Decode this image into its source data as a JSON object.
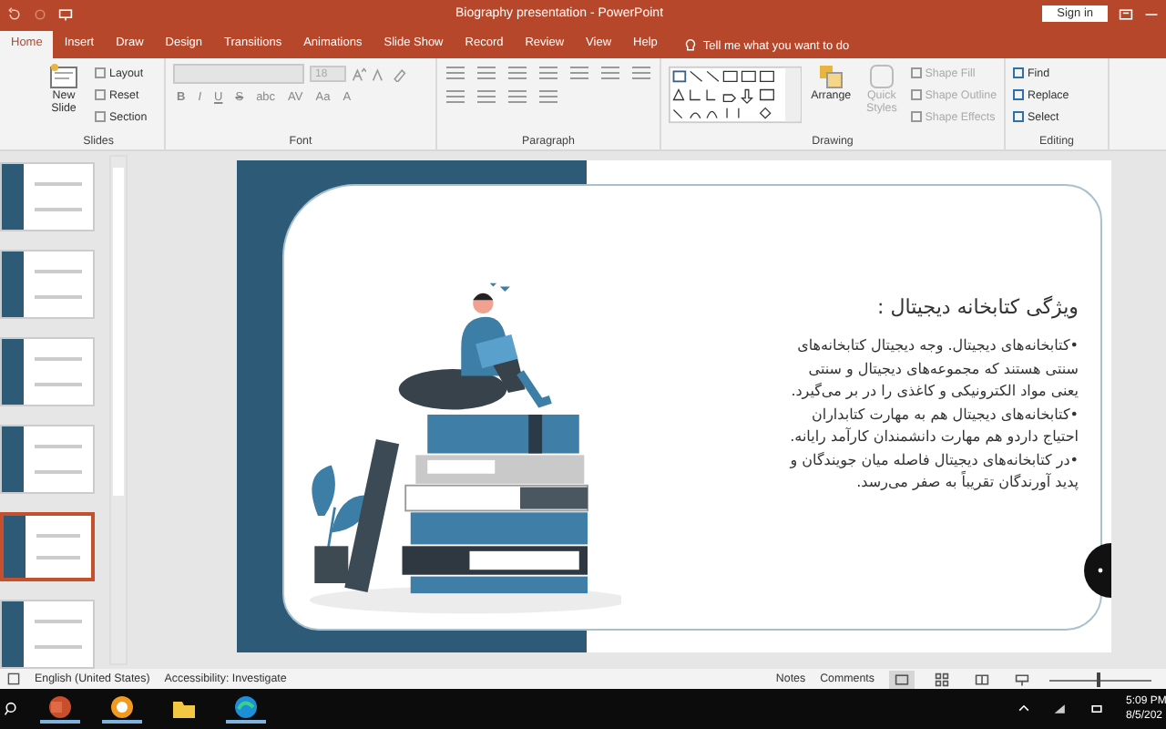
{
  "title_bar": {
    "title": "Biography presentation  -  PowerPoint",
    "sign_in": "Sign in"
  },
  "tabs": [
    {
      "label": "Home",
      "selected": true
    },
    {
      "label": "Insert",
      "selected": false
    },
    {
      "label": "Draw",
      "selected": false
    },
    {
      "label": "Design",
      "selected": false
    },
    {
      "label": "Transitions",
      "selected": false
    },
    {
      "label": "Animations",
      "selected": false
    },
    {
      "label": "Slide Show",
      "selected": false
    },
    {
      "label": "Record",
      "selected": false
    },
    {
      "label": "Review",
      "selected": false
    },
    {
      "label": "View",
      "selected": false
    },
    {
      "label": "Help",
      "selected": false
    }
  ],
  "tell_me": {
    "placeholder": "Tell me what you want to do"
  },
  "ribbon": {
    "slides": {
      "label": "Slides",
      "new_slide": "New Slide",
      "commands": [
        "Layout",
        "Reset",
        "Section"
      ]
    },
    "font": {
      "label": "Font",
      "font_size": "18",
      "buttons": [
        "B",
        "I",
        "U",
        "S",
        "abc",
        "AV",
        "Aa",
        "A"
      ]
    },
    "paragraph": {
      "label": "Paragraph"
    },
    "drawing": {
      "label": "Drawing",
      "arrange": "Arrange",
      "quick_styles": {
        "label": "Quick Styles",
        "disabled": true
      },
      "shape_commands": [
        {
          "label": "Shape Fill",
          "disabled": true
        },
        {
          "label": "Shape Outline",
          "disabled": true
        },
        {
          "label": "Shape Effects",
          "disabled": true
        }
      ]
    },
    "editing": {
      "label": "Editing",
      "commands": [
        "Find",
        "Replace",
        "Select"
      ]
    }
  },
  "thumbnails": [
    {
      "selected": false
    },
    {
      "selected": false
    },
    {
      "selected": false
    },
    {
      "selected": false
    },
    {
      "selected": true
    },
    {
      "selected": false
    }
  ],
  "slide": {
    "title": "ویژگی کتابخانه دیجیتال :",
    "lines": [
      "•کتابخانه‌های دیجیتال. وجه دیجیتال کتابخانه‌های",
      "سنتی هستند که مجموعه‌های دیجیتال و سنتی",
      "یعنی مواد الکترونیکی و کاغذی را در بر می‌گیرد.",
      "•کتابخانه‌های دیجیتال هم به مهارت کتابداران",
      "احتیاج داردو هم مهارت دانشمندان کارآمد رایانه.",
      "•در کتابخانه‌های دیجیتال فاصله میان جویندگان و",
      "پدید آورندگان تقریباً به صفر می‌رسد."
    ]
  },
  "status_bar": {
    "language": "English (United States)",
    "accessibility": "Accessibility: Investigate",
    "notes": "Notes",
    "comments": "Comments",
    "zoom": {
      "level": 0.48
    }
  },
  "taskbar": {
    "time": "5:09 PM",
    "date": "8/5/202"
  }
}
